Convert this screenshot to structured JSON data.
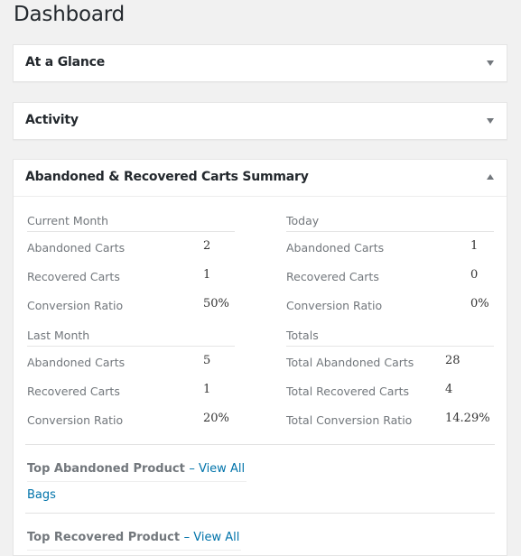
{
  "page": {
    "title": "Dashboard"
  },
  "widgets": {
    "at_a_glance": {
      "title": "At a Glance",
      "toggle": "collapsed"
    },
    "activity": {
      "title": "Activity",
      "toggle": "collapsed"
    },
    "carts_summary": {
      "title": "Abandoned & Recovered Carts Summary",
      "toggle": "expanded",
      "current_month": {
        "title": "Current Month",
        "rows": [
          {
            "label": "Abandoned Carts",
            "value": "2"
          },
          {
            "label": "Recovered Carts",
            "value": "1"
          },
          {
            "label": "Conversion Ratio",
            "value": "50%"
          }
        ]
      },
      "today": {
        "title": "Today",
        "rows": [
          {
            "label": "Abandoned Carts",
            "value": "1"
          },
          {
            "label": "Recovered Carts",
            "value": "0"
          },
          {
            "label": "Conversion Ratio",
            "value": "0%"
          }
        ]
      },
      "last_month": {
        "title": "Last Month",
        "rows": [
          {
            "label": "Abandoned Carts",
            "value": "5"
          },
          {
            "label": "Recovered Carts",
            "value": "1"
          },
          {
            "label": "Conversion Ratio",
            "value": "20%"
          }
        ]
      },
      "totals": {
        "title": "Totals",
        "rows": [
          {
            "label": "Total Abandoned Carts",
            "value": "28"
          },
          {
            "label": "Total Recovered Carts",
            "value": "4"
          },
          {
            "label": "Total Conversion Ratio",
            "value": "14.29%"
          }
        ]
      },
      "top_abandoned": {
        "title": "Top Abandoned Product",
        "view_all": "– View All",
        "products": [
          "Bags"
        ]
      },
      "top_recovered": {
        "title": "Top Recovered Product",
        "view_all": "– View All"
      }
    }
  },
  "colors": {
    "link": "#0073aa",
    "background": "#f1f1f1",
    "muted_text": "#72777c"
  }
}
